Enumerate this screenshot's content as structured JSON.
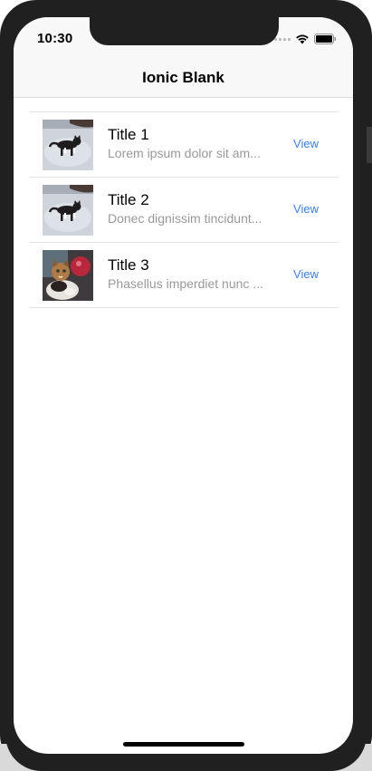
{
  "status_bar": {
    "time": "10:30",
    "wifi_icon": "wifi-icon",
    "battery_icon": "battery-icon"
  },
  "header": {
    "title": "Ionic Blank"
  },
  "items": [
    {
      "title": "Title 1",
      "description": "Lorem ipsum dolor sit am...",
      "action": "View",
      "thumbnail": "cat-on-snow-photo"
    },
    {
      "title": "Title 2",
      "description": "Donec dignissim tincidunt...",
      "action": "View",
      "thumbnail": "cat-on-snow-photo"
    },
    {
      "title": "Title 3",
      "description": "Phasellus imperdiet nunc ...",
      "action": "View",
      "thumbnail": "calico-kitten-photo"
    }
  ],
  "colors": {
    "accent": "#3880ff",
    "toolbar_bg": "#f8f8f8",
    "muted_text": "#999999"
  }
}
